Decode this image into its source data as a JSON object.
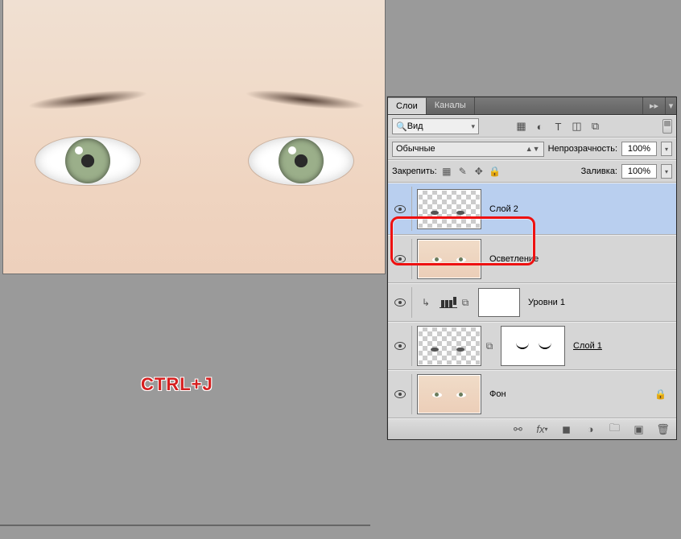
{
  "annotation": "CTRL+J",
  "panel": {
    "tabs": {
      "layers": "Слои",
      "channels": "Каналы"
    },
    "search_kind": "Вид",
    "blend_mode": "Обычные",
    "opacity_label": "Непрозрачность:",
    "opacity_value": "100%",
    "lock_label": "Закрепить:",
    "fill_label": "Заливка:",
    "fill_value": "100%"
  },
  "layers": [
    {
      "name": "Слой 2",
      "selected": true
    },
    {
      "name": "Осветление"
    },
    {
      "name": "Уровни 1"
    },
    {
      "name": "Слой 1"
    },
    {
      "name": "Фон",
      "locked": true
    }
  ]
}
